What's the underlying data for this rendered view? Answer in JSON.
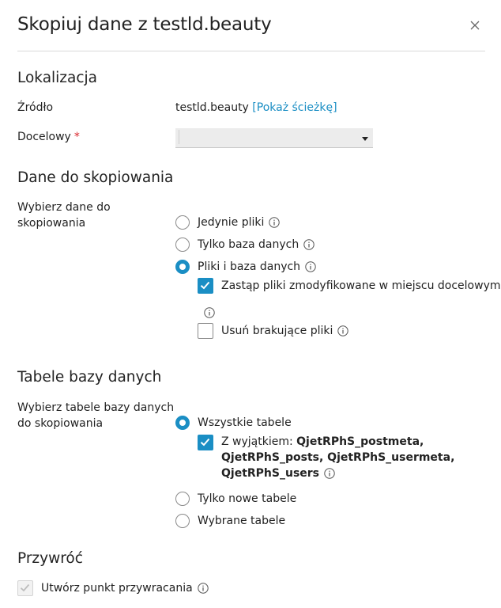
{
  "dialog": {
    "title": "Skopiuj dane z testld.beauty"
  },
  "location": {
    "section_title": "Lokalizacja",
    "source_label": "Źródło",
    "source_value": "testld.beauty",
    "show_path_link": "[Pokaż ścieżkę]",
    "target_label": "Docelowy",
    "required_mark": "*",
    "target_value": ""
  },
  "data_to_copy": {
    "section_title": "Dane do skopiowania",
    "label_line1": "Wybierz dane do",
    "label_line2": "skopiowania",
    "options": [
      {
        "label": "Jedynie pliki",
        "selected": false
      },
      {
        "label": "Tylko baza danych",
        "selected": false
      },
      {
        "label": "Pliki i baza danych",
        "selected": true
      }
    ],
    "replace_modified": {
      "label": "Zastąp pliki zmodyfikowane w miejscu docelowym",
      "checked": true
    },
    "remove_missing": {
      "label": "Usuń brakujące pliki",
      "checked": false
    }
  },
  "db_tables": {
    "section_title": "Tabele bazy danych",
    "label_line1": "Wybierz tabele bazy danych",
    "label_line2": "do skopiowania",
    "all_tables": {
      "label": "Wszystkie tabele",
      "selected": true
    },
    "except": {
      "prefix": "Z wyjątkiem: ",
      "line1_bold": "QjetRPhS_postmeta,",
      "line2_bold": "QjetRPhS_posts, QjetRPhS_usermeta,",
      "line3_bold": "QjetRPhS_users",
      "checked": true
    },
    "new_tables": {
      "label": "Tylko nowe tabele",
      "selected": false
    },
    "selected_tables": {
      "label": "Wybrane tabele",
      "selected": false
    }
  },
  "restore": {
    "section_title": "Przywróć",
    "create_restore_point": {
      "label": "Utwórz punkt przywracania",
      "checked": true,
      "disabled": true
    }
  },
  "colors": {
    "accent": "#1a8ec4",
    "required": "#d9262c"
  }
}
